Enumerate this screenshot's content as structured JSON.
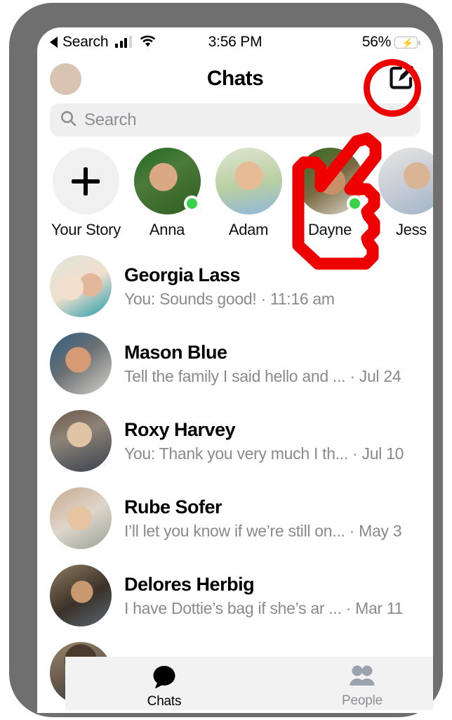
{
  "status_bar": {
    "carrier_back_label": "Search",
    "time": "3:56 PM",
    "battery_percent": "56%",
    "battery_level": 56,
    "charging": true,
    "signal_icon": "cellular-bars-icon",
    "wifi_icon": "wifi-icon"
  },
  "header": {
    "title": "Chats",
    "profile_avatar_icon": "profile-avatar",
    "compose_icon": "compose-pencil-square-icon"
  },
  "search": {
    "placeholder": "Search",
    "icon": "search-icon"
  },
  "stories": {
    "items": [
      {
        "label": "Your Story",
        "type": "add",
        "icon": "plus-icon",
        "online": false,
        "photo": "ph1"
      },
      {
        "label": "Anna",
        "type": "story",
        "online": true,
        "photo": "ph2"
      },
      {
        "label": "Adam",
        "type": "story",
        "online": false,
        "photo": "ph3"
      },
      {
        "label": "Dayne",
        "type": "story",
        "online": true,
        "photo": "ph4"
      },
      {
        "label": "Jess",
        "type": "story",
        "online": false,
        "photo": "ph5"
      }
    ]
  },
  "chats": {
    "rows": [
      {
        "name": "Georgia Lass",
        "preview": "You: Sounds good! · 11:16 am",
        "photo": "ph6"
      },
      {
        "name": "Mason Blue",
        "preview": "Tell the family I said hello and ... · Jul 24",
        "photo": "ph7"
      },
      {
        "name": "Roxy Harvey",
        "preview": "You: Thank you very much I th... · Jul 10",
        "photo": "ph8"
      },
      {
        "name": "Rube Sofer",
        "preview": "I’ll let you know if we’re still on... · May 3",
        "photo": "ph9"
      },
      {
        "name": "Delores Herbig",
        "preview": "I have Dottie’s bag if she’s ar  ... · Mar 11",
        "photo": "ph10"
      }
    ]
  },
  "tab_bar": {
    "tabs": [
      {
        "label": "Chats",
        "icon": "chat-bubble-icon",
        "active": true
      },
      {
        "label": "People",
        "icon": "people-icon",
        "active": false
      }
    ]
  },
  "annotation": {
    "highlight_target": "compose-button",
    "cursor_icon": "pointing-hand-cursor",
    "color": "#ee0000"
  },
  "colors": {
    "accent_green": "#3ad24a",
    "annotation_red": "#ee0000",
    "search_bg": "#efeff0",
    "muted_text": "#8a8a8e",
    "frame_gray": "#706f6f",
    "tab_bar_bg": "#f2f2f2"
  }
}
